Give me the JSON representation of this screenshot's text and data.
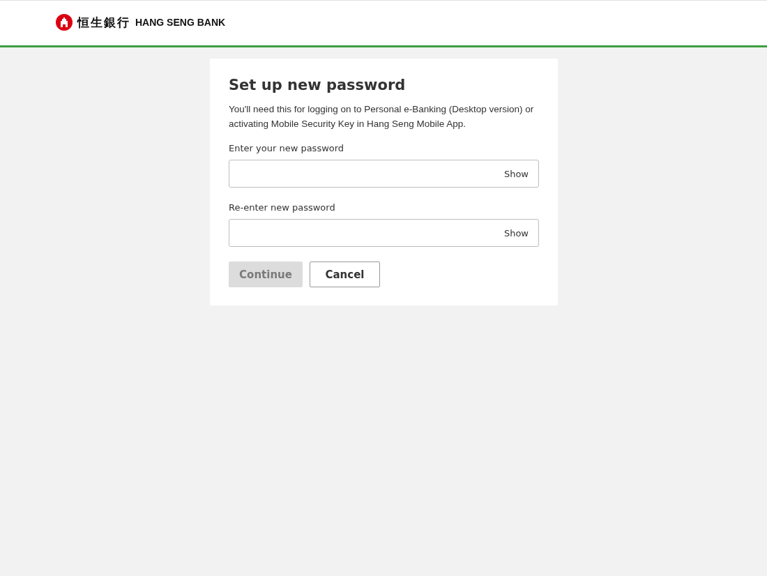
{
  "header": {
    "logo_chinese": "恒生銀行",
    "logo_text": "HANG SENG BANK"
  },
  "card": {
    "title": "Set up new password",
    "description": "You'll need this for logging on to Personal e-Banking (Desktop version) or activating Mobile Security Key in Hang Seng Mobile App.",
    "fields": [
      {
        "label": "Enter your new password",
        "toggle": "Show"
      },
      {
        "label": "Re-enter new password",
        "toggle": "Show"
      }
    ],
    "buttons": [
      {
        "label": "Continue",
        "kind": "primary",
        "disabled": true
      },
      {
        "label": "Cancel",
        "kind": "secondary",
        "disabled": false
      }
    ]
  }
}
